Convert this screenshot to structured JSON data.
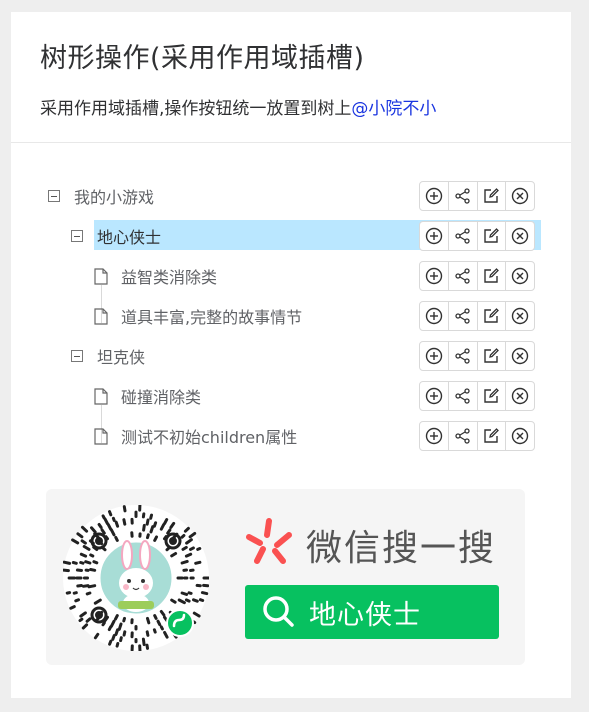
{
  "header": {
    "title": "树形操作(采用作用域插槽)",
    "subtitle": "采用作用域插槽,操作按钮统一放置到树上",
    "author_link": "@小院不小"
  },
  "tree": {
    "nodes": [
      {
        "label": "我的小游戏",
        "type": "folder",
        "expanded": true,
        "level": 0
      },
      {
        "label": "地心侠士",
        "type": "folder",
        "expanded": true,
        "level": 1,
        "selected": true
      },
      {
        "label": "益智类消除类",
        "type": "leaf",
        "level": 2
      },
      {
        "label": "道具丰富,完整的故事情节",
        "type": "leaf",
        "level": 2
      },
      {
        "label": "坦克侠",
        "type": "folder",
        "expanded": true,
        "level": 1
      },
      {
        "label": "碰撞消除类",
        "type": "leaf",
        "level": 2
      },
      {
        "label": "测试不初始children属性",
        "type": "leaf",
        "level": 2
      }
    ],
    "action_icons": [
      "add-circle-icon",
      "share-icon",
      "edit-icon",
      "close-circle-icon"
    ]
  },
  "promo": {
    "wechat_search": "微信搜一搜",
    "keyword": "地心侠士"
  },
  "colors": {
    "selected_bg": "#bae7ff",
    "link": "#1a35e0",
    "wechat_green": "#07c160",
    "wechat_logo_red": "#fa5151"
  }
}
